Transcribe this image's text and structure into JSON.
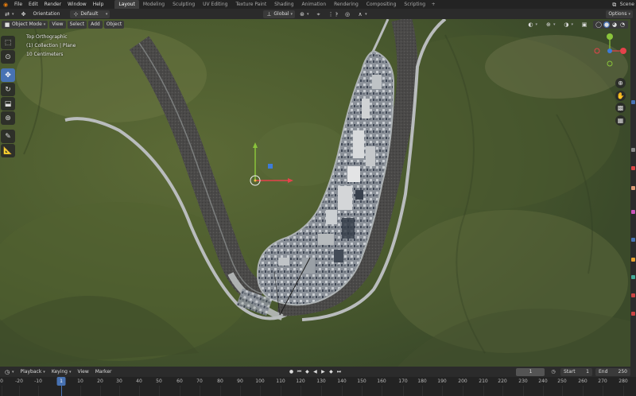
{
  "menu": {
    "items": [
      "File",
      "Edit",
      "Render",
      "Window",
      "Help"
    ]
  },
  "workspaces": {
    "tabs": [
      "Layout",
      "Modeling",
      "Sculpting",
      "UV Editing",
      "Texture Paint",
      "Shading",
      "Animation",
      "Rendering",
      "Compositing",
      "Scripting"
    ],
    "active": "Layout",
    "add": "+"
  },
  "scene": {
    "label": "Scene"
  },
  "header": {
    "orientation_label": "Orientation",
    "orientation_value": "Default",
    "transform_space": "Global",
    "options_label": "Options",
    "mode": "Object Mode",
    "view": "View",
    "select": "Select",
    "add": "Add",
    "object": "Object"
  },
  "viewport_overlay": {
    "line1": "Top Orthographic",
    "line2": "(1) Collection | Plane",
    "line3": "10 Centimeters"
  },
  "toolbar": {
    "tools": [
      "select-box-icon",
      "cursor-icon",
      "move-icon",
      "rotate-icon",
      "scale-icon",
      "transform-icon",
      "annotate-icon",
      "measure-icon"
    ],
    "active_tool": "move-icon"
  },
  "gizmo": {
    "x_label": "X",
    "y_label": "Y",
    "z_label": "Z",
    "x_color": "#e5424b",
    "y_color": "#8ac43b",
    "z_color": "#3d7bd9"
  },
  "timeline": {
    "playback": "Playback",
    "keying": "Keying",
    "view": "View",
    "marker": "Marker",
    "current_frame": "1",
    "start_label": "Start",
    "start_value": "1",
    "end_label": "End",
    "end_value": "250",
    "ticks": [
      "0",
      "-20",
      "-10",
      "1",
      "10",
      "20",
      "30",
      "40",
      "50",
      "60",
      "70",
      "80",
      "90",
      "100",
      "110",
      "120",
      "130",
      "140",
      "150",
      "160",
      "170",
      "180",
      "190",
      "200",
      "210",
      "220",
      "230",
      "240",
      "250",
      "260",
      "270",
      "280"
    ],
    "cursor_frame": "1"
  },
  "colors": {
    "accent": "#4772b3",
    "blender_orange": "#e87d0d"
  }
}
